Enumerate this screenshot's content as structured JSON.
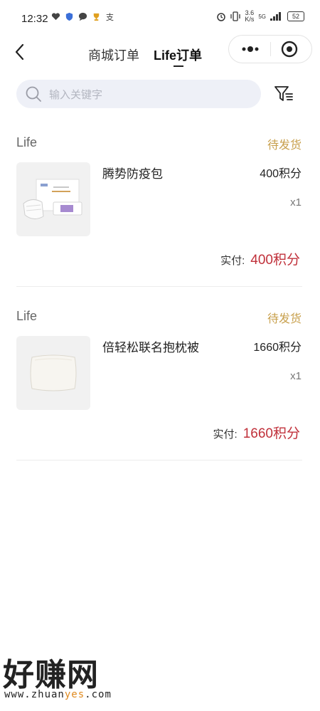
{
  "status_bar": {
    "time": "12:32",
    "net_speed_top": "3.6",
    "net_speed_bottom": "K/s",
    "signal": "5G",
    "battery": "52"
  },
  "nav": {
    "tabs": [
      {
        "label": "商城订单",
        "active": false
      },
      {
        "label": "Life订单",
        "active": true
      }
    ]
  },
  "search": {
    "placeholder": "输入关键字",
    "value": ""
  },
  "orders": [
    {
      "store": "Life",
      "status": "待发货",
      "product_name": "腾势防疫包",
      "price": "400积分",
      "quantity": "x1",
      "pay_label": "实付:",
      "pay_value": "400积分"
    },
    {
      "store": "Life",
      "status": "待发货",
      "product_name": "倍轻松联名抱枕被",
      "price": "1660积分",
      "quantity": "x1",
      "pay_label": "实付:",
      "pay_value": "1660积分"
    }
  ],
  "watermark": {
    "title": "好赚网",
    "url_prefix": "www.zhuan",
    "url_highlight": "yes",
    "url_suffix": ".com"
  },
  "colors": {
    "status_pending": "#c8a04d",
    "pay_value": "#c0303a",
    "search_bg": "#eef0f7"
  }
}
